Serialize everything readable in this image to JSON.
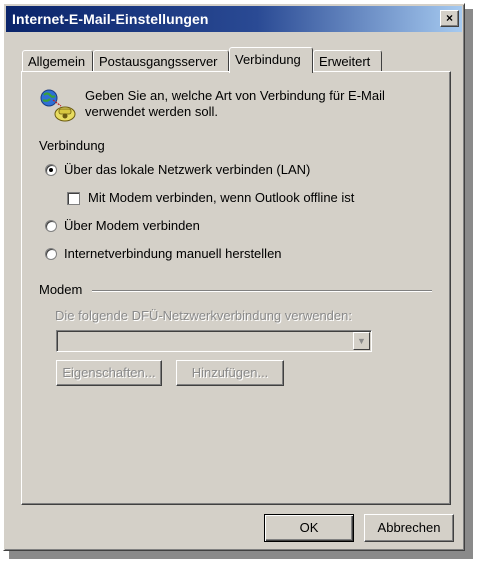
{
  "window": {
    "title": "Internet-E-Mail-Einstellungen",
    "close_glyph": "×"
  },
  "tabs": [
    {
      "label": "Allgemein",
      "active": false
    },
    {
      "label": "Postausgangsserver",
      "active": false
    },
    {
      "label": "Verbindung",
      "active": true
    },
    {
      "label": "Erweitert",
      "active": false
    }
  ],
  "intro": {
    "icon": "network-connection-icon",
    "text": "Geben Sie an, welche Art von Verbindung für E-Mail verwendet werden soll."
  },
  "connection_group": {
    "label": "Verbindung",
    "options": [
      {
        "label": "Über das lokale Netzwerk verbinden (LAN)",
        "type": "radio",
        "checked": true
      },
      {
        "label": "Mit Modem verbinden, wenn Outlook offline ist",
        "type": "checkbox",
        "checked": false
      },
      {
        "label": "Über Modem verbinden",
        "type": "radio",
        "checked": false
      },
      {
        "label": "Internetverbindung manuell herstellen",
        "type": "radio",
        "checked": false
      }
    ]
  },
  "modem_group": {
    "label": "Modem",
    "dfu_label": "Die folgende DFÜ-Netzwerkverbindung verwenden:",
    "dfu_value": "",
    "properties_button": "Eigenschaften...",
    "add_button": "Hinzufügen..."
  },
  "footer": {
    "ok_label": "OK",
    "cancel_label": "Abbrechen"
  },
  "colors": {
    "dialog_face": "#d4d0c8",
    "titlebar_start": "#0a246a",
    "titlebar_end": "#a6caf0",
    "disabled_text": "#8a8a8a"
  }
}
